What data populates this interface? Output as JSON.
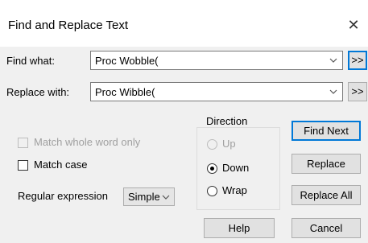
{
  "dialog": {
    "title": "Find and Replace Text"
  },
  "find": {
    "label": "Find what:",
    "value": "Proc Wobble(",
    "more_label": ">>"
  },
  "replace": {
    "label": "Replace with:",
    "value": "Proc Wibble(",
    "more_label": ">>"
  },
  "options": {
    "match_whole_word": {
      "label": "Match whole word only",
      "checked": false,
      "enabled": false
    },
    "match_case": {
      "label": "Match case",
      "checked": false,
      "enabled": true
    },
    "regex": {
      "label": "Regular expression",
      "value": "Simple"
    }
  },
  "direction": {
    "title": "Direction",
    "up": {
      "label": "Up",
      "selected": false,
      "enabled": false
    },
    "down": {
      "label": "Down",
      "selected": true,
      "enabled": true
    },
    "wrap": {
      "label": "Wrap",
      "selected": false,
      "enabled": true
    }
  },
  "buttons": {
    "find_next": "Find Next",
    "replace": "Replace",
    "replace_all": "Replace All",
    "help": "Help",
    "cancel": "Cancel"
  },
  "colors": {
    "accent": "#0078d7",
    "background": "#f0f0f0",
    "titlebar": "#ffffff"
  }
}
